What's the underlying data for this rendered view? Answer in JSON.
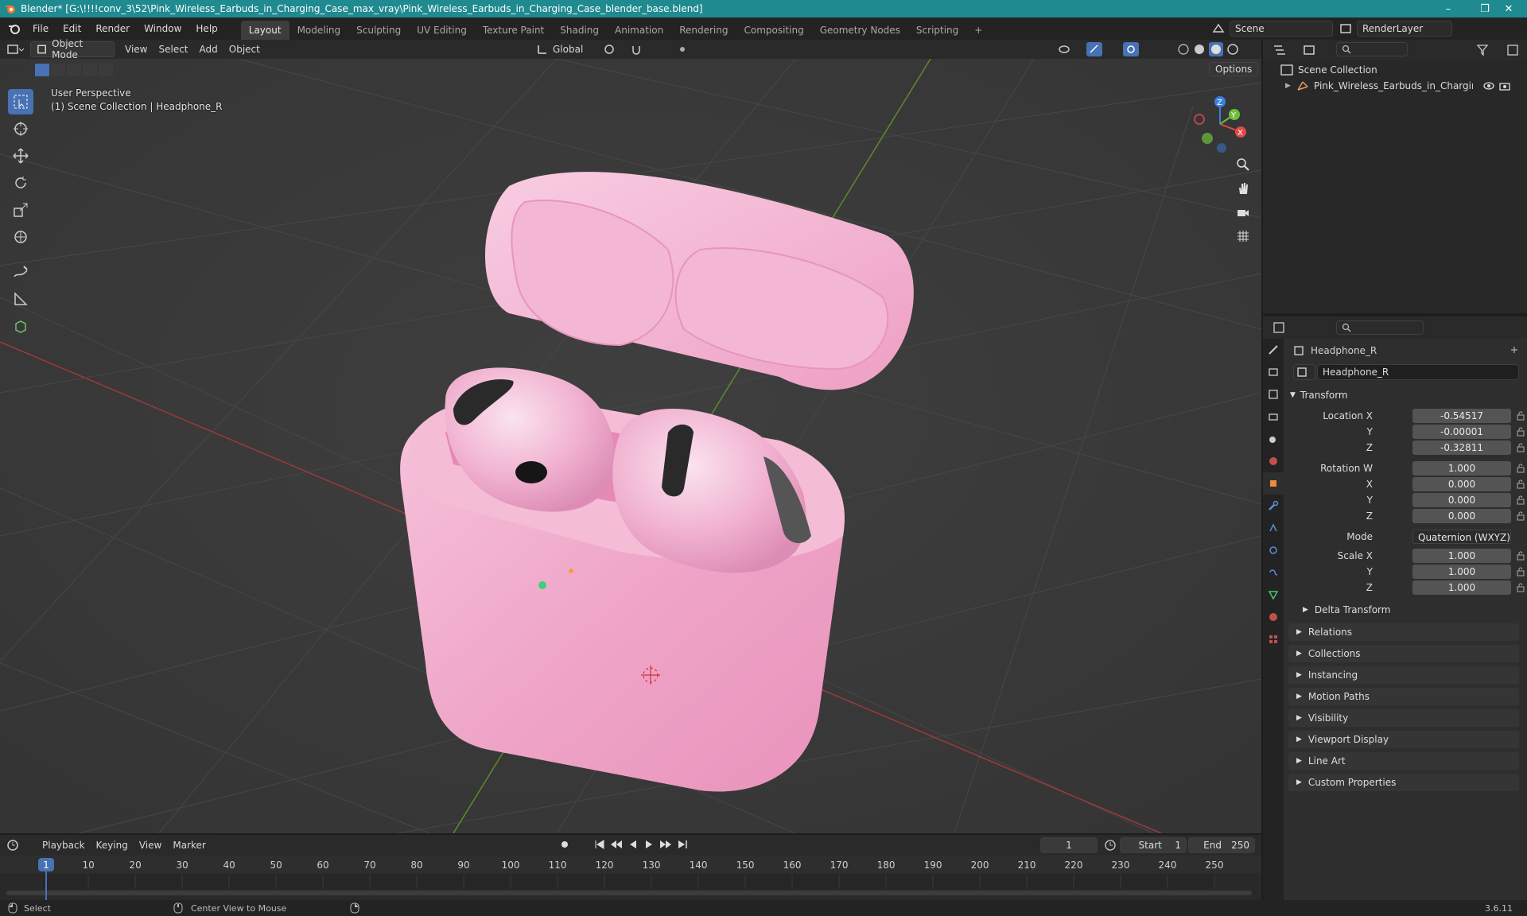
{
  "window": {
    "title": "Blender* [G:\\!!!!conv_3\\52\\Pink_Wireless_Earbuds_in_Charging_Case_max_vray\\Pink_Wireless_Earbuds_in_Charging_Case_blender_base.blend]",
    "minimize": "–",
    "maximize": "❐",
    "close": "✕"
  },
  "menu": [
    "File",
    "Edit",
    "Render",
    "Window",
    "Help"
  ],
  "workspaces": [
    "Layout",
    "Modeling",
    "Sculpting",
    "UV Editing",
    "Texture Paint",
    "Shading",
    "Animation",
    "Rendering",
    "Compositing",
    "Geometry Nodes",
    "Scripting",
    "+"
  ],
  "active_workspace": "Layout",
  "scene": {
    "name": "Scene",
    "render_layer": "RenderLayer"
  },
  "viewport_header": {
    "mode": "Object Mode",
    "menus": [
      "View",
      "Select",
      "Add",
      "Object"
    ],
    "transform_orientation": "Global",
    "options": "Options"
  },
  "viewport": {
    "perspective": "User Perspective",
    "collection_info": "(1) Scene Collection | Headphone_R",
    "axes": {
      "x": "X",
      "y": "Y",
      "z": "Z"
    }
  },
  "outliner": {
    "root": "Scene Collection",
    "items": [
      {
        "name": "Pink_Wireless_Earbuds_in_Charging_Cas"
      }
    ]
  },
  "properties": {
    "object_name": "Headphone_R",
    "object_field": "Headphone_R",
    "transform_label": "Transform",
    "location": {
      "label": "Location X",
      "x": "-0.54517",
      "y": "-0.00001",
      "z": "-0.32811"
    },
    "rotation": {
      "label": "Rotation W",
      "w": "1.000",
      "x": "0.000",
      "y": "0.000",
      "z": "0.000"
    },
    "mode_label": "Mode",
    "mode_value": "Quaternion (WXYZ)",
    "scale": {
      "label": "Scale X",
      "x": "1.000",
      "y": "1.000",
      "z": "1.000"
    },
    "axis_labels": {
      "y": "Y",
      "z": "Z",
      "x": "X"
    },
    "delta_transform": "Delta Transform",
    "panels": [
      "Relations",
      "Collections",
      "Instancing",
      "Motion Paths",
      "Visibility",
      "Viewport Display",
      "Line Art",
      "Custom Properties"
    ]
  },
  "timeline": {
    "menus": [
      "Playback",
      "Keying",
      "View",
      "Marker"
    ],
    "current_frame": "1",
    "start_label": "Start",
    "start": "1",
    "end_label": "End",
    "end": "250",
    "ticks": [
      "1",
      "10",
      "20",
      "30",
      "40",
      "50",
      "60",
      "70",
      "80",
      "90",
      "100",
      "110",
      "120",
      "130",
      "140",
      "150",
      "160",
      "170",
      "180",
      "190",
      "200",
      "210",
      "220",
      "230",
      "240",
      "250"
    ]
  },
  "statusbar": {
    "select": "Select",
    "center_view": "Center View to Mouse",
    "version": "3.6.11"
  }
}
